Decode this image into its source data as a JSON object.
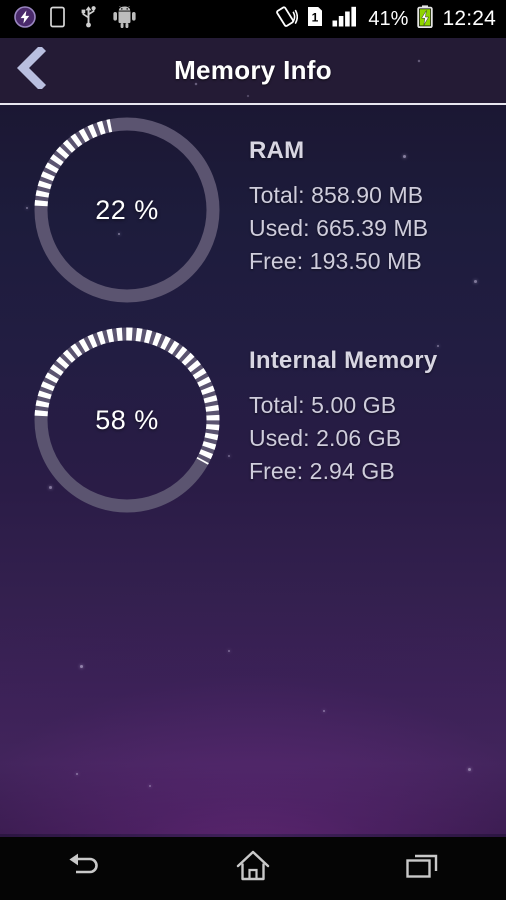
{
  "status_bar": {
    "icons_left": [
      "flash-charge-icon",
      "sim-card-icon",
      "usb-icon",
      "android-robot-icon"
    ],
    "icons_right": [
      "vibrate-icon",
      "sim-1-icon",
      "signal-bars-icon",
      "battery-charging-icon"
    ],
    "battery_percent": "41%",
    "clock": "12:24"
  },
  "header": {
    "back_icon": "back-chevron-icon",
    "title": "Memory Info"
  },
  "memory": [
    {
      "id": "ram",
      "title": "RAM",
      "percent": 22,
      "percent_label": "22 %",
      "lines": [
        "Total: 858.90 MB",
        "Used: 665.39 MB",
        "Free: 193.50 MB"
      ]
    },
    {
      "id": "internal",
      "title": "Internal Memory",
      "percent": 58,
      "percent_label": "58 %",
      "lines": [
        "Total: 5.00 GB",
        "Used: 2.06 GB",
        "Free: 2.94 GB"
      ]
    }
  ],
  "nav_bar": {
    "back_label": "back-icon",
    "home_label": "home-icon",
    "recents_label": "recents-icon"
  },
  "colors": {
    "header_bg": "#241b35",
    "gauge_track": "#5b5470",
    "gauge_progress": "#ffffff",
    "title_text": "#ffffff",
    "body_text": "#cfcddc",
    "battery_green": "#8fd400"
  }
}
